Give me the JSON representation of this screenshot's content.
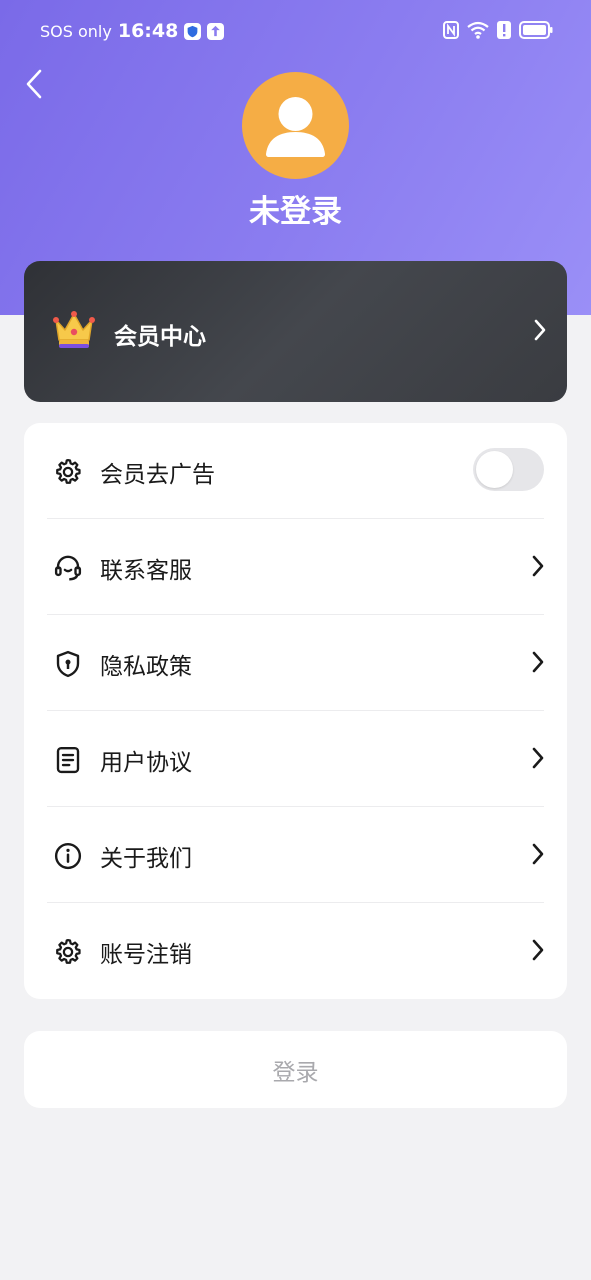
{
  "status_bar": {
    "carrier": "SOS only",
    "time": "16:48",
    "icons": [
      "shield-badge-icon",
      "upload-badge-icon",
      "nfc-icon",
      "wifi-icon",
      "alert-icon",
      "battery-icon"
    ]
  },
  "header": {
    "back_icon": "chevron-left-icon",
    "avatar_icon": "user-silhouette-icon",
    "user_name": "未登录"
  },
  "vip": {
    "icon": "crown-icon",
    "title": "会员中心"
  },
  "menu": {
    "items": [
      {
        "label": "会员去广告",
        "icon": "gear-icon",
        "control": "toggle",
        "toggle_on": false
      },
      {
        "label": "联系客服",
        "icon": "headset-icon",
        "control": "chevron"
      },
      {
        "label": "隐私政策",
        "icon": "shield-lock-icon",
        "control": "chevron"
      },
      {
        "label": "用户协议",
        "icon": "document-icon",
        "control": "chevron"
      },
      {
        "label": "关于我们",
        "icon": "info-icon",
        "control": "chevron"
      },
      {
        "label": "账号注销",
        "icon": "gear-icon",
        "control": "chevron"
      }
    ]
  },
  "login": {
    "label": "登录"
  },
  "colors": {
    "header_gradient_start": "#7a6ae8",
    "header_gradient_end": "#9a8ff7",
    "avatar_bg": "#f5ad45",
    "vip_card_bg": "#3a3c41",
    "page_bg": "#f2f2f4",
    "login_text": "#a9a9ad"
  }
}
